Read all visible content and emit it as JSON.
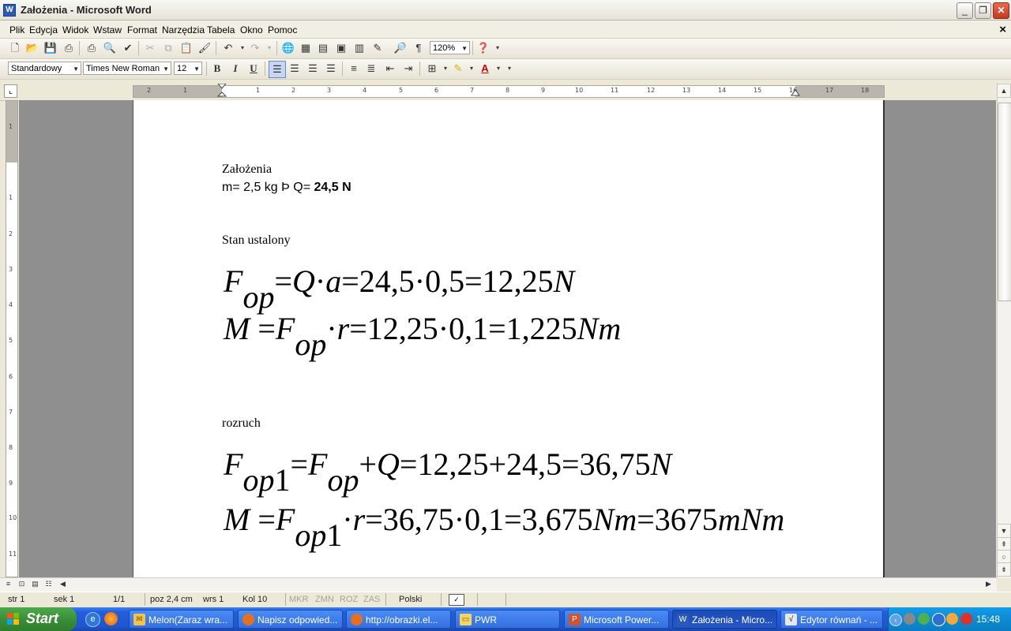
{
  "window": {
    "title": "Założenia - Microsoft Word",
    "app_icon_letter": "W"
  },
  "menu": {
    "items": [
      "Plik",
      "Edycja",
      "Widok",
      "Wstaw",
      "Format",
      "Narzędzia",
      "Tabela",
      "Okno",
      "Pomoc"
    ],
    "close_doc": "×"
  },
  "standard_toolbar": {
    "zoom": "120%"
  },
  "formatting_toolbar": {
    "style": "Standardowy",
    "font": "Times New Roman",
    "size": "12",
    "bold": "B",
    "italic": "I",
    "underline": "U"
  },
  "ruler": {
    "ticks": [
      "2",
      "1",
      "1",
      "2",
      "3",
      "4",
      "5",
      "6",
      "7",
      "8",
      "9",
      "10",
      "11",
      "12",
      "13",
      "14",
      "15",
      "16",
      "17",
      "18"
    ]
  },
  "vruler": {
    "ticks": [
      "1",
      "1",
      "2",
      "3",
      "4",
      "5",
      "6",
      "7",
      "8",
      "9",
      "10",
      "11"
    ]
  },
  "document": {
    "heading1": "Założenia",
    "line2_plain": "m= 2,5 kg Þ Q= ",
    "line2_bold": "24,5 N",
    "section1": "Stan ustalony",
    "eq1": {
      "var": "F",
      "sub": "op",
      "rest_a": "=",
      "q": "Q",
      "dot": "·",
      "a": "a",
      "nums": "=24,5·0,5=12,25",
      "unit": "N"
    },
    "eq2": {
      "var": "M",
      "eq": " =",
      "f": "F",
      "sub": "op",
      "dot": "·",
      "r": "r",
      "nums": "=12,25·0,1=1,225",
      "unit": "Nm"
    },
    "section2": "rozruch",
    "eq3": {
      "var": "F",
      "sub": "op",
      "sub1": "1",
      "eq": "=",
      "f": "F",
      "sub2": "op",
      "plus": "+",
      "q": "Q",
      "nums": "=12,25+24,5=36,75",
      "unit": "N"
    },
    "eq4": {
      "var": "M",
      "eq": " =",
      "f": "F",
      "sub": "op",
      "sub1": "1",
      "dot": "·",
      "r": "r",
      "nums": "=36,75·0,1=3,675",
      "unit": "Nm",
      "eq2": "=3675",
      "unit2": "mNm"
    }
  },
  "statusbar": {
    "page": "str  1",
    "section": "sek  1",
    "pages": "1/1",
    "position": "poz  2,4 cm",
    "line": "wrs  1",
    "col": "Kol  10",
    "mkr": "MKR",
    "zmn": "ZMN",
    "roz": "ROZ",
    "zas": "ZAS",
    "language": "Polski"
  },
  "taskbar": {
    "start": "Start",
    "tasks": [
      "Melon(Zaraz wra...",
      "Napisz odpowied...",
      "http://obrazki.el...",
      "PWR",
      "Microsoft Power...",
      "Założenia - Micro...",
      "Edytor równań - ..."
    ],
    "clock": "15:48"
  }
}
